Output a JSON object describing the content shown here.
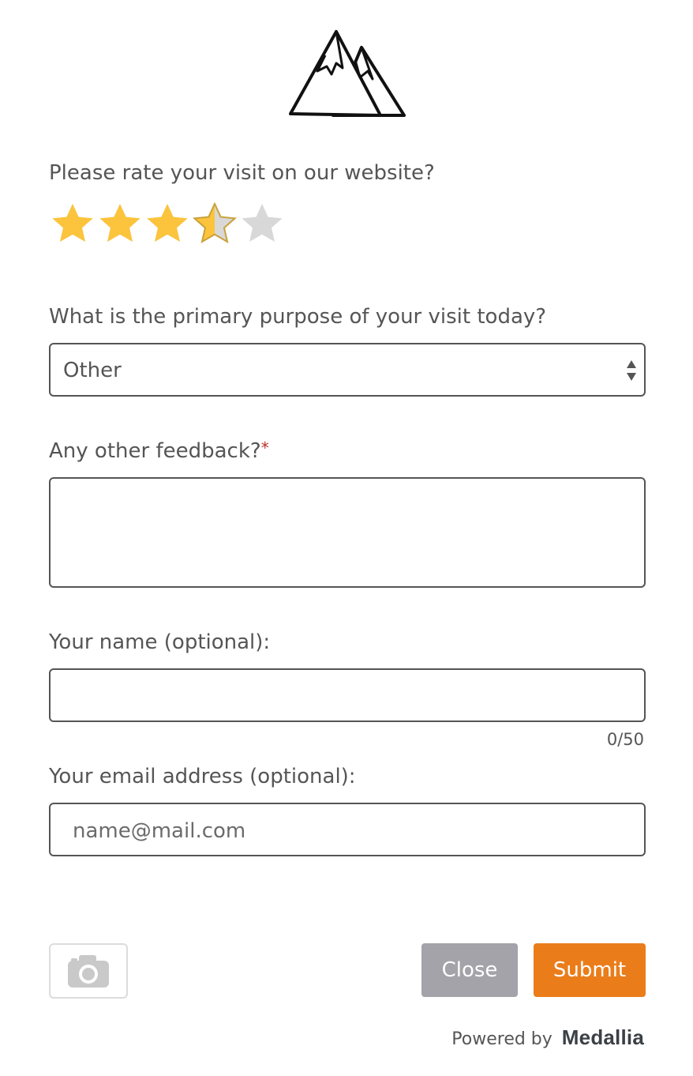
{
  "logo": {
    "icon": "mountains-logo-icon"
  },
  "rating": {
    "question": "Please rate your visit on our website?",
    "value": 3.5,
    "max": 5,
    "filled_color": "#fcc43c",
    "empty_color": "#d8d8d8"
  },
  "purpose": {
    "question": "What is the primary purpose of your visit today?",
    "selected": "Other"
  },
  "feedback": {
    "question": "Any other feedback?",
    "required_mark": "*",
    "value": ""
  },
  "name": {
    "question": "Your name (optional):",
    "value": "",
    "char_count": "0/50"
  },
  "email": {
    "question": "Your email address (optional):",
    "placeholder": "name@mail.com",
    "value": ""
  },
  "screenshot": {
    "icon": "camera-icon"
  },
  "buttons": {
    "close_label": "Close",
    "submit_label": "Submit",
    "close_color": "#a3a3a9",
    "submit_color": "#ea7d1a"
  },
  "footer": {
    "powered_by": "Powered by",
    "brand": "Medallia"
  }
}
